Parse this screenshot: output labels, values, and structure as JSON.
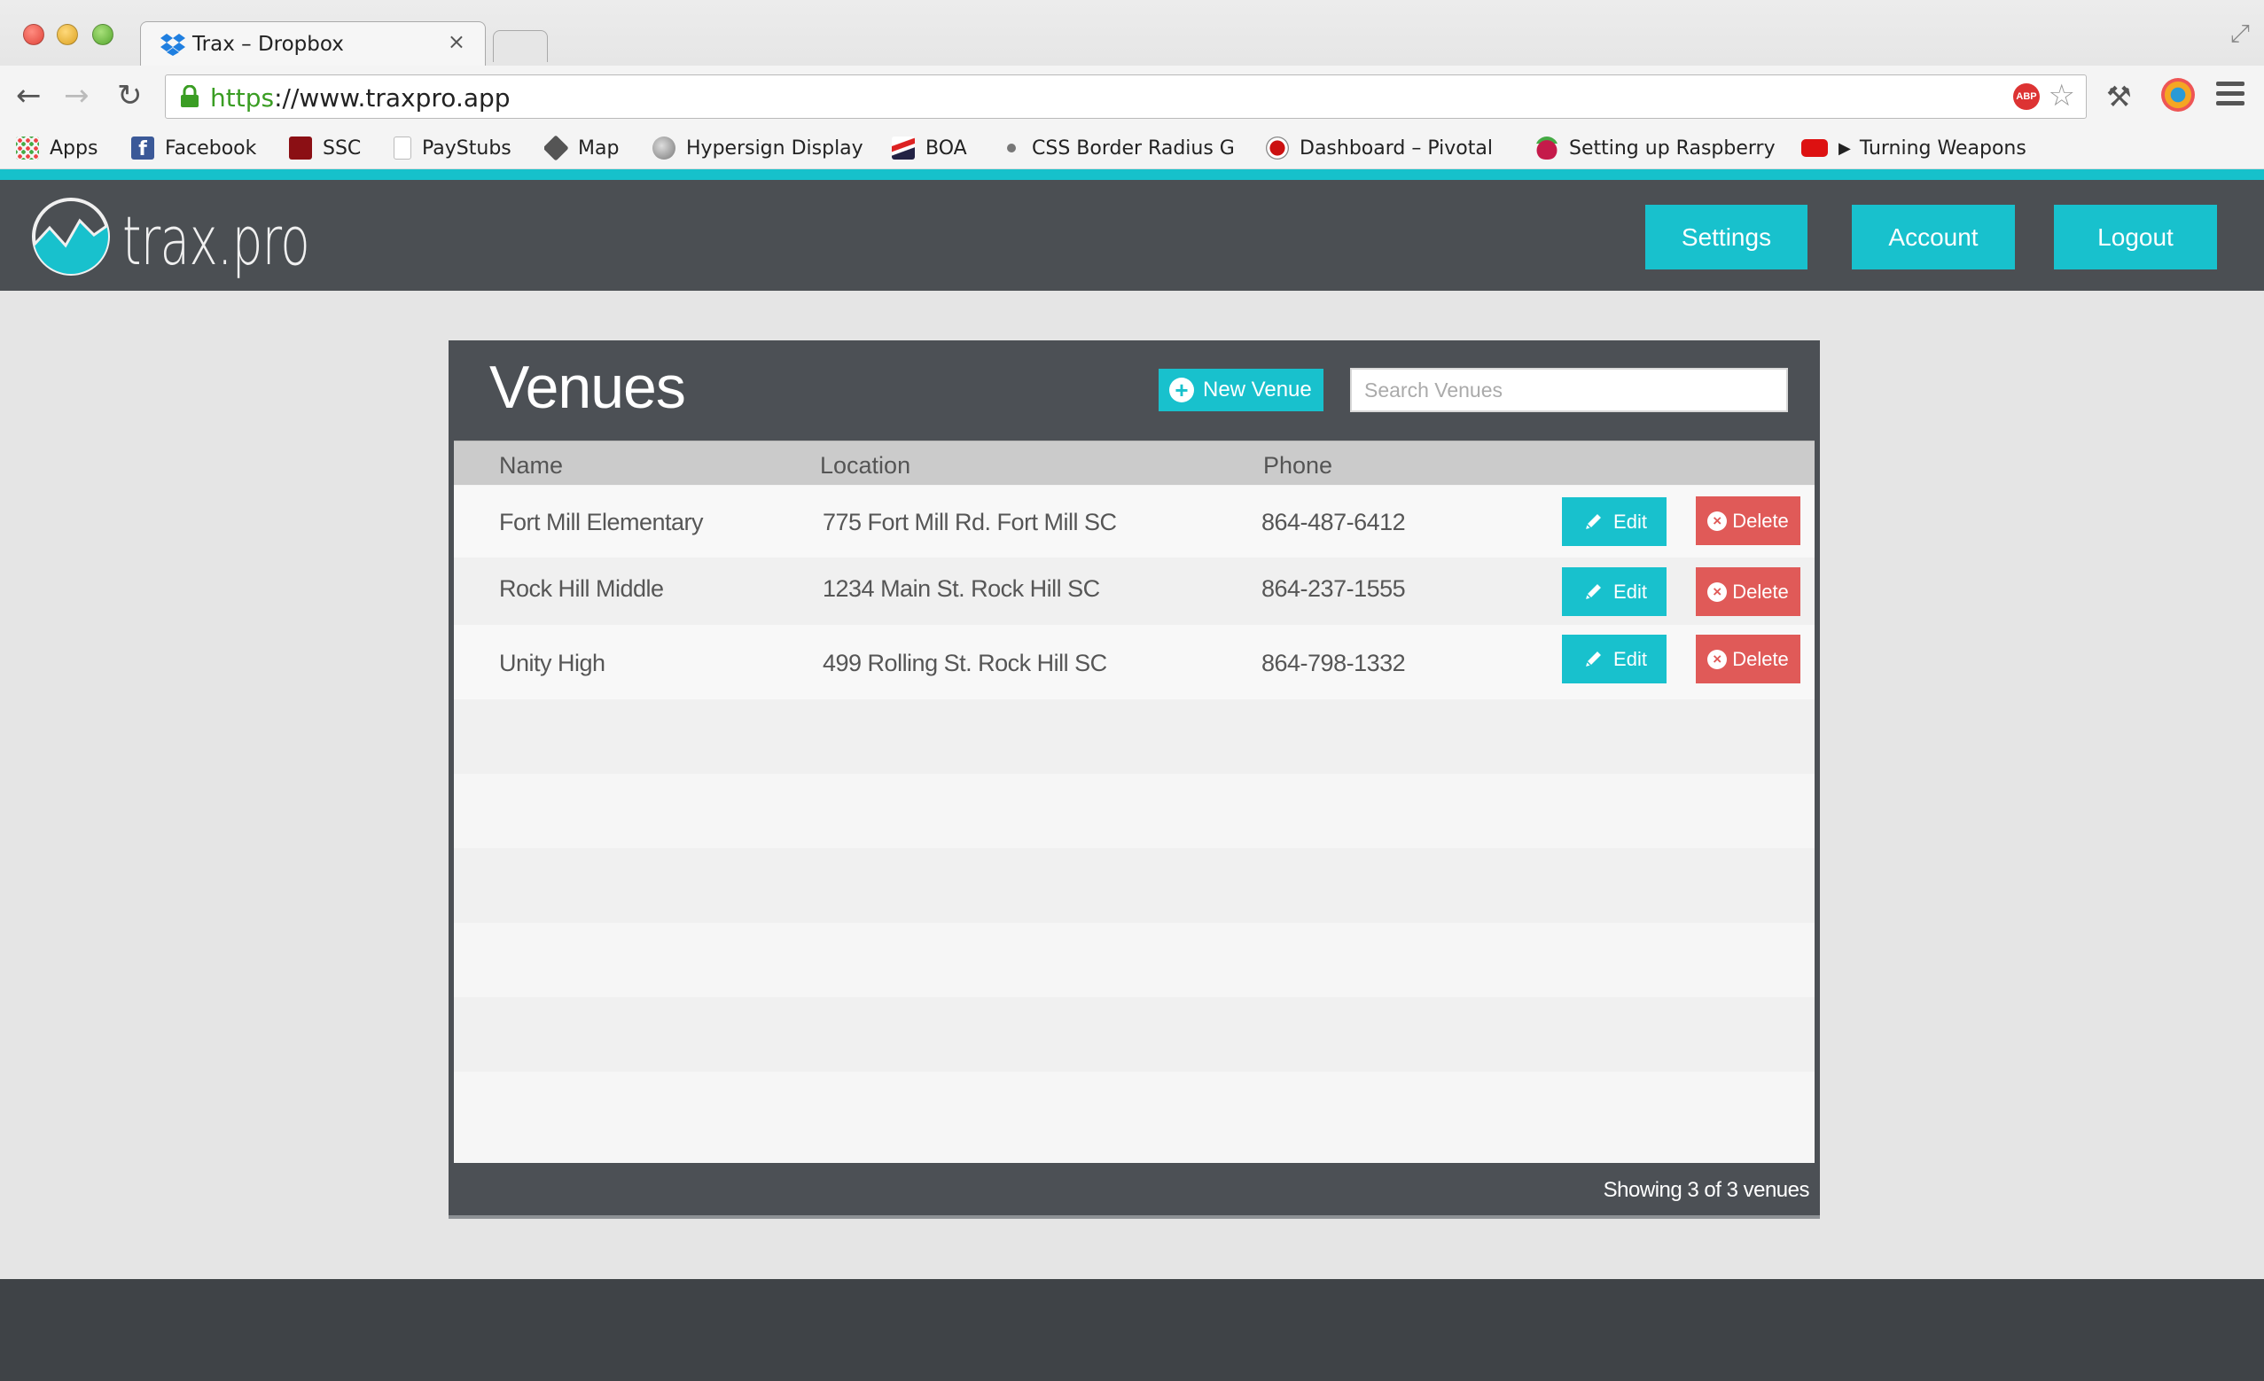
{
  "browser": {
    "tab_title": "Trax – Dropbox",
    "tab_close": "×",
    "url_scheme": "https",
    "url_rest": "://www.traxpro.app",
    "abp_label": "ABP",
    "bookmarks": [
      {
        "label": "Apps",
        "icon": "apps-grid-icon"
      },
      {
        "label": "Facebook",
        "icon": "facebook-icon"
      },
      {
        "label": "SSC",
        "icon": "ssc-icon"
      },
      {
        "label": "PayStubs",
        "icon": "page-icon"
      },
      {
        "label": "Map",
        "icon": "cube-icon"
      },
      {
        "label": "Hypersign Display",
        "icon": "globe-icon"
      },
      {
        "label": "BOA",
        "icon": "boa-flag-icon"
      },
      {
        "label": "CSS Border Radius G",
        "icon": "dot-icon"
      },
      {
        "label": "Dashboard – Pivotal",
        "icon": "pivotal-icon"
      },
      {
        "label": "Setting up Raspberry",
        "icon": "raspberry-icon"
      },
      {
        "label": "Turning Weapons",
        "icon": "youtube-icon"
      }
    ]
  },
  "app": {
    "logo_text": "trax.pro",
    "nav": {
      "settings": "Settings",
      "account": "Account",
      "logout": "Logout"
    }
  },
  "venues": {
    "title": "Venues",
    "new_button": "New Venue",
    "search_placeholder": "Search Venues",
    "columns": {
      "name": "Name",
      "location": "Location",
      "phone": "Phone"
    },
    "rows": [
      {
        "name": "Fort Mill Elementary",
        "location": "775 Fort Mill Rd. Fort Mill SC",
        "phone": "864-487-6412"
      },
      {
        "name": "Rock Hill Middle",
        "location": "1234 Main St. Rock Hill SC",
        "phone": "864-237-1555"
      },
      {
        "name": "Unity High",
        "location": "499 Rolling St. Rock Hill SC",
        "phone": "864-798-1332"
      }
    ],
    "edit_label": "Edit",
    "delete_label": "Delete",
    "footer_text": "Showing 3 of 3 venues"
  },
  "colors": {
    "accent": "#18c1cd",
    "danger": "#e05a58",
    "header_bg": "#4b4f53"
  }
}
